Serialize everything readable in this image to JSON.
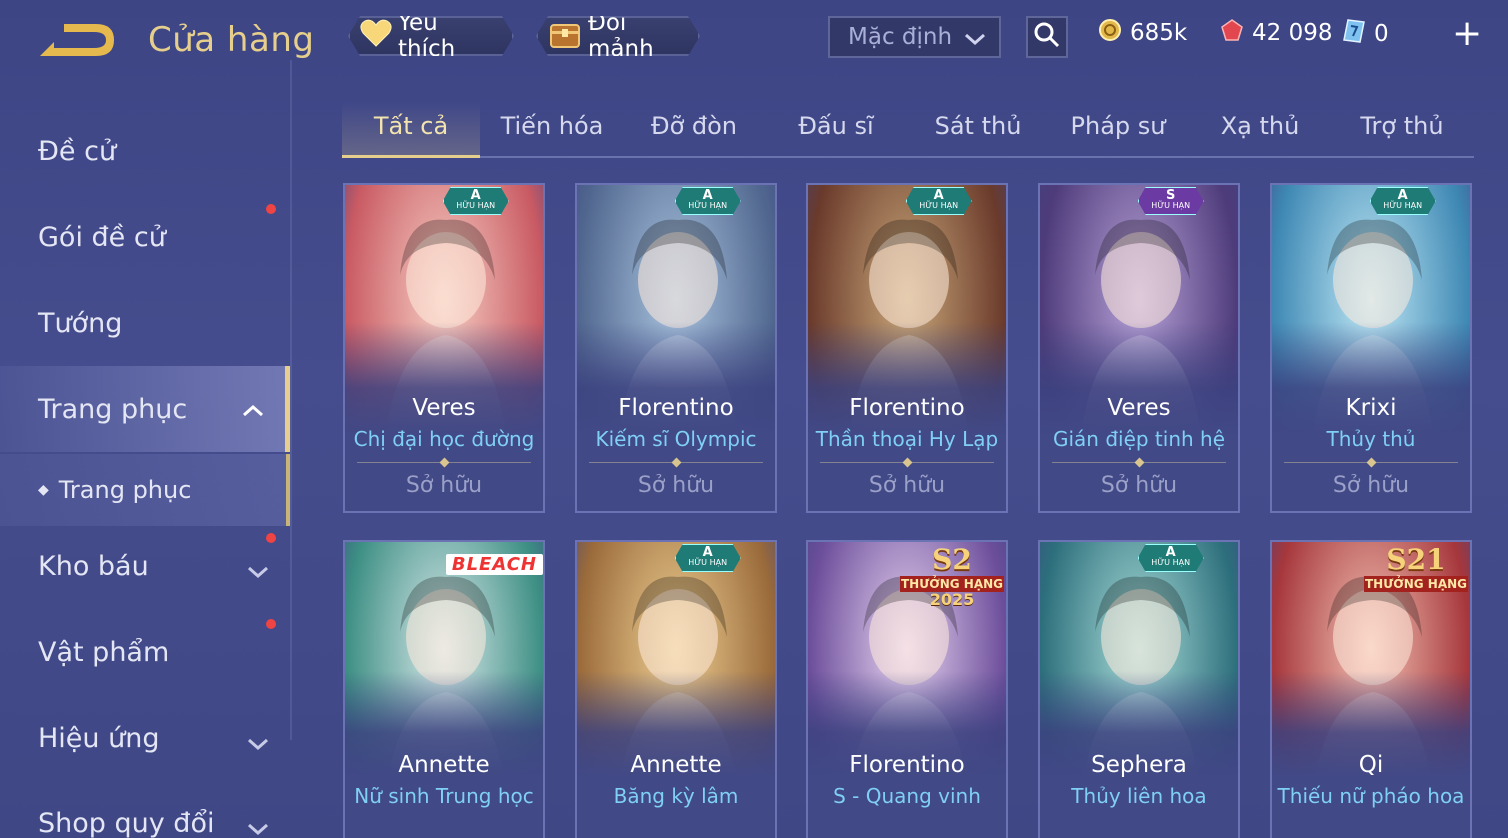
{
  "header": {
    "title": "Cửa hàng",
    "favorite_label": "Yêu thích",
    "exchange_label": "Đổi mảnh",
    "sort_value": "Mặc định",
    "gold": "685k",
    "ruby": "42 098",
    "gem": "0",
    "plus": "+"
  },
  "sidebar": {
    "items": [
      {
        "label": "Đề cử"
      },
      {
        "label": "Gói đề cử"
      },
      {
        "label": "Tướng"
      },
      {
        "label": "Trang phục"
      },
      {
        "label": "Trang phục"
      },
      {
        "label": "Kho báu"
      },
      {
        "label": "Vật phẩm"
      },
      {
        "label": "Hiệu ứng"
      },
      {
        "label": "Shop quy đổi"
      }
    ]
  },
  "tabs": [
    "Tất cả",
    "Tiến hóa",
    "Đỡ đòn",
    "Đấu sĩ",
    "Sát thủ",
    "Pháp sư",
    "Xạ thủ",
    "Trợ thủ"
  ],
  "cards": [
    {
      "hero": "Veres",
      "skin": "Chị đại học đường",
      "status": "Sở hữu",
      "badge_rank": "A",
      "badge_text": "HỮU HẠN",
      "theme": [
        "#f6cfc4",
        "#c95a63"
      ]
    },
    {
      "hero": "Florentino",
      "skin": "Kiếm sĩ Olympic",
      "status": "Sở hữu",
      "badge_rank": "A",
      "badge_text": "HỮU HẠN",
      "theme": [
        "#a9c3de",
        "#51678f"
      ]
    },
    {
      "hero": "Florentino",
      "skin": "Thần thoại Hy Lạp",
      "status": "Sở hữu",
      "badge_rank": "A",
      "badge_text": "HỮU HẠN",
      "theme": [
        "#c9a87a",
        "#6a3a2b"
      ]
    },
    {
      "hero": "Veres",
      "skin": "Gián điệp tinh hệ",
      "status": "Sở hữu",
      "badge_rank": "S",
      "badge_text": "HỮU HẠN",
      "theme": [
        "#b8a2d8",
        "#4e3b7a"
      ]
    },
    {
      "hero": "Krixi",
      "skin": "Thủy thủ",
      "status": "Sở hữu",
      "badge_rank": "A",
      "badge_text": "HỮU HẠN",
      "theme": [
        "#bfe7f4",
        "#3e88b4"
      ]
    },
    {
      "hero": "Annette",
      "skin": "Nữ sinh Trung học",
      "bleach": "BLEACH",
      "theme": [
        "#d9e8ea",
        "#3d8f84"
      ]
    },
    {
      "hero": "Annette",
      "skin": "Băng kỳ lâm",
      "badge_rank": "A",
      "badge_text": "HỮU HẠN",
      "theme": [
        "#eecf93",
        "#9a6a3a"
      ]
    },
    {
      "hero": "Florentino",
      "skin": "S - Quang vinh",
      "season_big": "S2",
      "season_band": "THƯỞNG HẠNG",
      "season_year": "2025",
      "theme": [
        "#e8d4f0",
        "#6c4e9b"
      ]
    },
    {
      "hero": "Sephera",
      "skin": "Thủy liên hoa",
      "badge_rank": "A",
      "badge_text": "HỮU HẠN",
      "theme": [
        "#a8dcd8",
        "#2d6f7c"
      ]
    },
    {
      "hero": "Qi",
      "skin": "Thiếu nữ pháo hoa",
      "season_big": "S21",
      "season_band": "THƯỞNG HẠNG",
      "theme": [
        "#f3c2b4",
        "#a6373c"
      ]
    }
  ]
}
